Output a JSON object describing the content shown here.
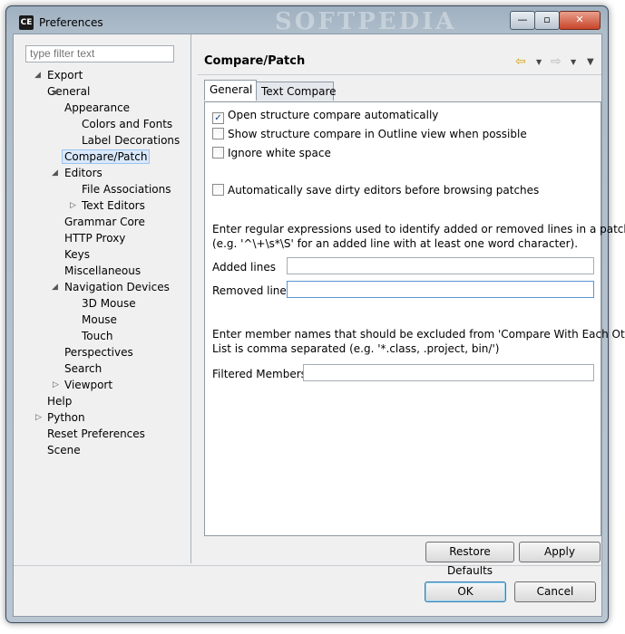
{
  "window": {
    "title": "Preferences",
    "app_icon": "CE",
    "watermark": "SOFTPEDIA",
    "min_glyph": "—",
    "max_glyph": "▫",
    "close_glyph": "✕"
  },
  "filter": {
    "placeholder": "type filter text"
  },
  "tree": [
    {
      "label": "Export"
    },
    {
      "label": "General",
      "expanded": true
    },
    {
      "label": "Appearance",
      "expanded": true
    },
    {
      "label": "Colors and Fonts"
    },
    {
      "label": "Label Decorations"
    },
    {
      "label": "Compare/Patch",
      "selected": true
    },
    {
      "label": "Editors",
      "expanded": true
    },
    {
      "label": "File Associations"
    },
    {
      "label": "Text Editors",
      "collapsed": true
    },
    {
      "label": "Grammar Core"
    },
    {
      "label": "HTTP Proxy"
    },
    {
      "label": "Keys"
    },
    {
      "label": "Miscellaneous"
    },
    {
      "label": "Navigation Devices",
      "expanded": true
    },
    {
      "label": "3D Mouse"
    },
    {
      "label": "Mouse"
    },
    {
      "label": "Touch"
    },
    {
      "label": "Perspectives"
    },
    {
      "label": "Search"
    },
    {
      "label": "Viewport",
      "collapsed": true
    },
    {
      "label": "Help"
    },
    {
      "label": "Python",
      "collapsed": true
    },
    {
      "label": "Reset Preferences"
    },
    {
      "label": "Scene"
    }
  ],
  "page": {
    "title": "Compare/Patch",
    "back_icon": "back-arrow-icon",
    "forward_icon": "forward-arrow-icon",
    "tabs": [
      "General",
      "Text Compare"
    ],
    "options": [
      {
        "label": "Open structure compare automatically",
        "checked": true
      },
      {
        "label": "Show structure compare in Outline view when possible",
        "checked": false
      },
      {
        "label": "Ignore white space",
        "checked": false
      },
      {
        "label": "Automatically save dirty editors before browsing patches",
        "checked": false
      }
    ],
    "regex_help_1": "Enter regular expressions used to identify added or removed lines in a patch",
    "regex_help_2": "(e.g. '^\\+\\s*\\S' for an added line with at least one word character).",
    "added_label": "Added lines",
    "removed_label": "Removed lines",
    "added_value": "",
    "removed_value": "",
    "members_help_1": "Enter member names that should be excluded from 'Compare With Each Other'.",
    "members_help_2": "List is comma separated (e.g. '*.class, .project, bin/')",
    "filtered_label": "Filtered Members:",
    "filtered_value": ""
  },
  "buttons": {
    "restore": "Restore Defaults",
    "apply": "Apply",
    "ok": "OK",
    "cancel": "Cancel"
  },
  "colors": {
    "selection": "#d9e9fb",
    "nav_arrow": "#d6a31a"
  }
}
